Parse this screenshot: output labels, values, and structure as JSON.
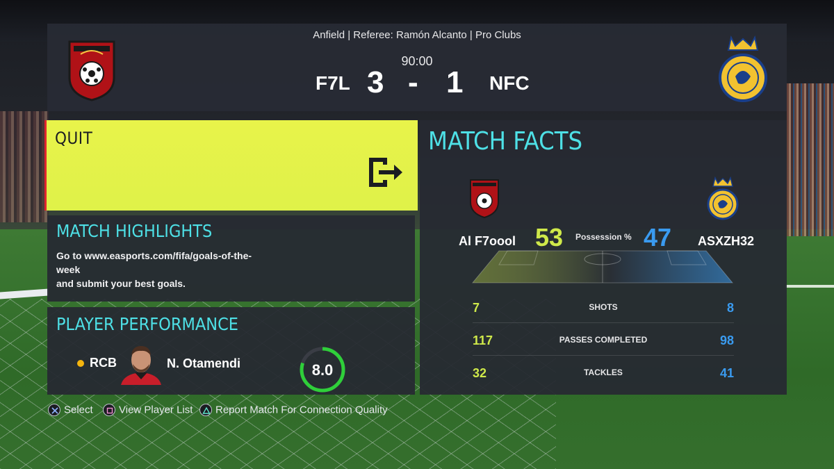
{
  "header": {
    "venue_line": "Anfield | Referee: Ramón Alcanto | Pro Clubs",
    "clock": "90:00",
    "home_abbr": "F7L",
    "away_abbr": "NFC",
    "home_score": "3",
    "separator": "-",
    "away_score": "1"
  },
  "quit": {
    "label": "QUIT",
    "icon": "exit-icon"
  },
  "highlights": {
    "title": "MATCH HIGHLIGHTS",
    "line1": "Go to www.easports.com/fifa/goals-of-the-",
    "line2": "week",
    "line3": "and submit your best goals."
  },
  "player_performance": {
    "title": "PLAYER PERFORMANCE",
    "position": "RCB",
    "name": "N. Otamendi",
    "rating": "8.0"
  },
  "match_facts": {
    "title": "MATCH FACTS",
    "home_name": "Al F7oool",
    "away_name": "ASXZH32",
    "possession_label": "Possession %",
    "possession_home": "53",
    "possession_away": "47",
    "stats": [
      {
        "label": "SHOTS",
        "home": "7",
        "away": "8"
      },
      {
        "label": "PASSES COMPLETED",
        "home": "117",
        "away": "98"
      },
      {
        "label": "TACKLES",
        "home": "32",
        "away": "41"
      }
    ]
  },
  "footer": {
    "select": "Select",
    "view_player_list": "View Player List",
    "report": "Report Match For Connection Quality"
  },
  "colors": {
    "accent_cyan": "#4ee0e6",
    "quit_yellow": "#e4f34a",
    "home_color": "#cfe94a",
    "away_color": "#3a9bf0",
    "rating_ring": "#2fcf3a"
  }
}
